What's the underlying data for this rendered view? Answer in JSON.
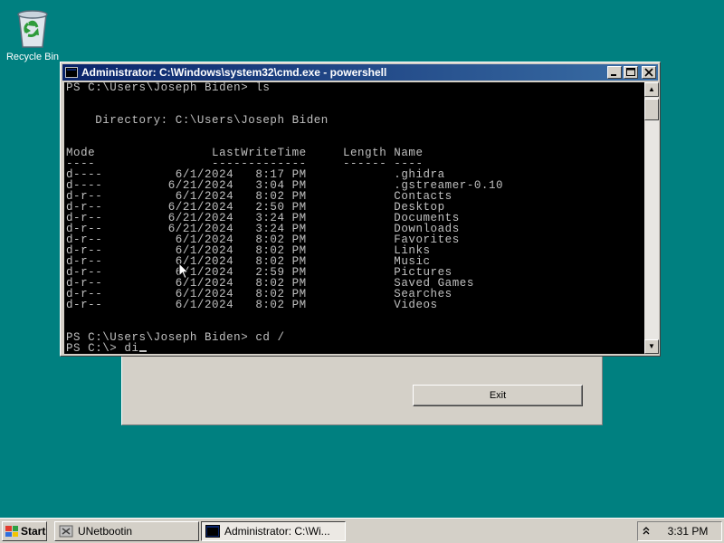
{
  "desktop": {
    "icons": [
      {
        "label": "Recycle Bin",
        "icon": "recycle-bin-icon"
      }
    ]
  },
  "console": {
    "title": "Administrator: C:\\Windows\\system32\\cmd.exe - powershell",
    "lines": [
      "PS C:\\Users\\Joseph Biden> ls",
      "",
      "",
      "    Directory: C:\\Users\\Joseph Biden",
      "",
      "",
      "Mode                LastWriteTime     Length Name",
      "----                -------------     ------ ----",
      "d----          6/1/2024   8:17 PM            .ghidra",
      "d----         6/21/2024   3:04 PM            .gstreamer-0.10",
      "d-r--          6/1/2024   8:02 PM            Contacts",
      "d-r--         6/21/2024   2:50 PM            Desktop",
      "d-r--         6/21/2024   3:24 PM            Documents",
      "d-r--         6/21/2024   3:24 PM            Downloads",
      "d-r--          6/1/2024   8:02 PM            Favorites",
      "d-r--          6/1/2024   8:02 PM            Links",
      "d-r--          6/1/2024   8:02 PM            Music",
      "d-r--          6/1/2024   2:59 PM            Pictures",
      "d-r--          6/1/2024   8:02 PM            Saved Games",
      "d-r--          6/1/2024   8:02 PM            Searches",
      "d-r--          6/1/2024   8:02 PM            Videos",
      "",
      "",
      "PS C:\\Users\\Joseph Biden> cd /"
    ],
    "prompt": "PS C:\\> ",
    "input": "di"
  },
  "dialog": {
    "exit_label": "Exit"
  },
  "taskbar": {
    "start_label": "Start",
    "tasks": [
      {
        "label": "UNetbootin",
        "icon": "unetbootin-icon",
        "active": false
      },
      {
        "label": "Administrator: C:\\Wi...",
        "icon": "console-icon",
        "active": true
      }
    ],
    "clock": "3:31 PM"
  },
  "colors": {
    "desktop": "#008080",
    "titlebar": "#0a246a",
    "console_bg": "#000000",
    "console_fg": "#c0c0c0"
  }
}
